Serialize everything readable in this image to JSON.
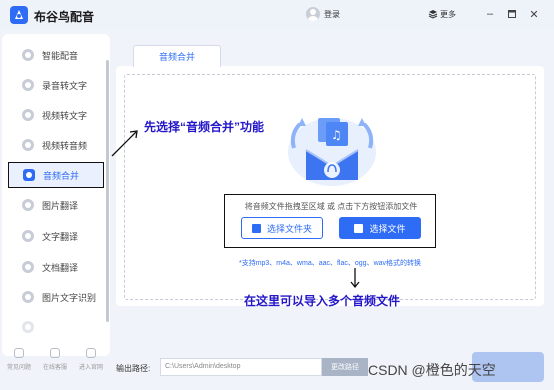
{
  "app": {
    "title": "布谷鸟配音",
    "brand_color": "#2e6cf6",
    "logo_icon": "bird-logo-icon"
  },
  "header": {
    "login_label": "登录",
    "more_label": "更多"
  },
  "sidebar": {
    "items": [
      {
        "label": "智能配音",
        "icon": "smart-dub-icon"
      },
      {
        "label": "录音转文字",
        "icon": "record-to-text-icon"
      },
      {
        "label": "视频转文字",
        "icon": "video-to-text-icon"
      },
      {
        "label": "视频转音频",
        "icon": "video-to-audio-icon"
      },
      {
        "label": "音频合并",
        "icon": "audio-merge-icon",
        "active": true
      },
      {
        "label": "图片翻译",
        "icon": "image-translate-icon"
      },
      {
        "label": "文字翻译",
        "icon": "text-translate-icon"
      },
      {
        "label": "文档翻译",
        "icon": "doc-translate-icon"
      },
      {
        "label": "图片文字识别",
        "icon": "ocr-icon"
      }
    ],
    "bottom_links": [
      {
        "label": "常见问题",
        "icon": "faq-icon"
      },
      {
        "label": "在线客服",
        "icon": "service-icon"
      },
      {
        "label": "进入官网",
        "icon": "website-icon"
      }
    ]
  },
  "main": {
    "tab_label": "音频合并",
    "drop_text": "将音频文件拖拽至区域 或 点击下方按钮添加文件",
    "select_folder_label": "选择文件夹",
    "select_file_label": "选择文件",
    "formats_text": "*支持mp3、m4a、wma、aac、flac、ogg、wav格式的转换"
  },
  "annotations": {
    "top": "先选择“音频合并”功能",
    "bottom": "在这里可以导入多个音频文件",
    "color": "#2417c9"
  },
  "footer": {
    "output_label": "输出路径:",
    "output_path": "C:\\Users\\Admin\\desktop",
    "change_dir_label": "更改路径"
  },
  "watermark": "CSDN @橙色的天空"
}
